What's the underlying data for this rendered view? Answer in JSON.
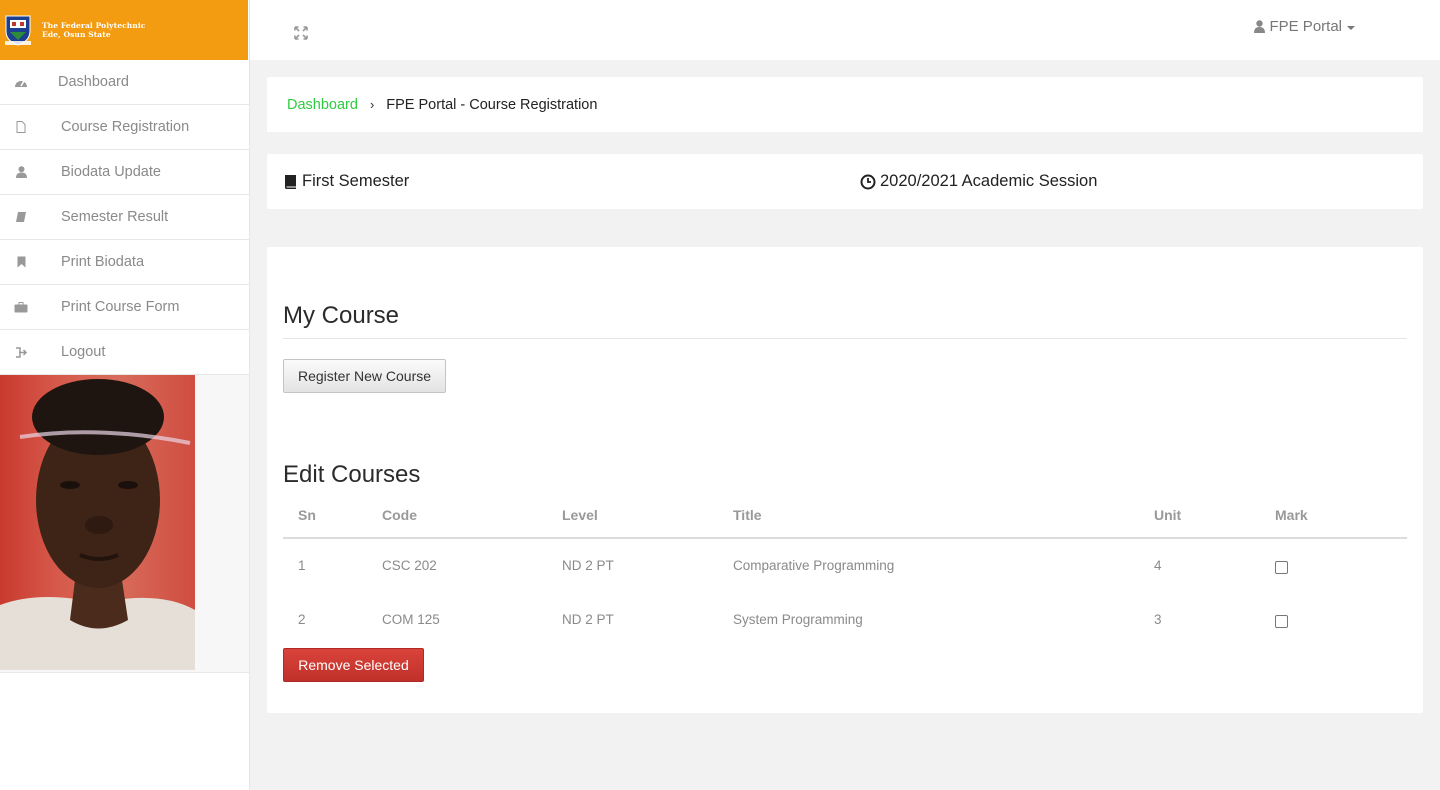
{
  "brand": {
    "line1": "The Federal Polytechnic",
    "line2": "Ede, Osun State",
    "color": "#f39c12"
  },
  "sidebar": {
    "items": [
      {
        "label": "Dashboard",
        "icon": "dashboard-icon"
      },
      {
        "label": "Course Registration",
        "icon": "file-icon"
      },
      {
        "label": "Biodata Update",
        "icon": "user-icon"
      },
      {
        "label": "Semester Result",
        "icon": "book-icon"
      },
      {
        "label": "Print Biodata",
        "icon": "bookmark-icon"
      },
      {
        "label": "Print Course Form",
        "icon": "briefcase-icon"
      },
      {
        "label": "Logout",
        "icon": "sign-out-icon"
      }
    ]
  },
  "topbar": {
    "user_label": "FPE Portal"
  },
  "breadcrumb": {
    "home": "Dashboard",
    "current": "FPE Portal - Course Registration"
  },
  "session": {
    "semester": "First Semester",
    "academic_session": "2020/2021 Academic Session"
  },
  "my_course": {
    "heading": "My Course",
    "register_button": "Register New Course"
  },
  "edit_courses": {
    "heading": "Edit Courses",
    "columns": [
      "Sn",
      "Code",
      "Level",
      "Title",
      "Unit",
      "Mark"
    ],
    "rows": [
      {
        "sn": "1",
        "code": "CSC 202",
        "level": "ND 2 PT",
        "title": "Comparative Programming",
        "unit": "4"
      },
      {
        "sn": "2",
        "code": "COM 125",
        "level": "ND 2 PT",
        "title": "System Programming",
        "unit": "3"
      }
    ],
    "remove_button": "Remove Selected"
  },
  "colors": {
    "accent_green": "#2ecc40",
    "danger_red": "#c9302c"
  }
}
